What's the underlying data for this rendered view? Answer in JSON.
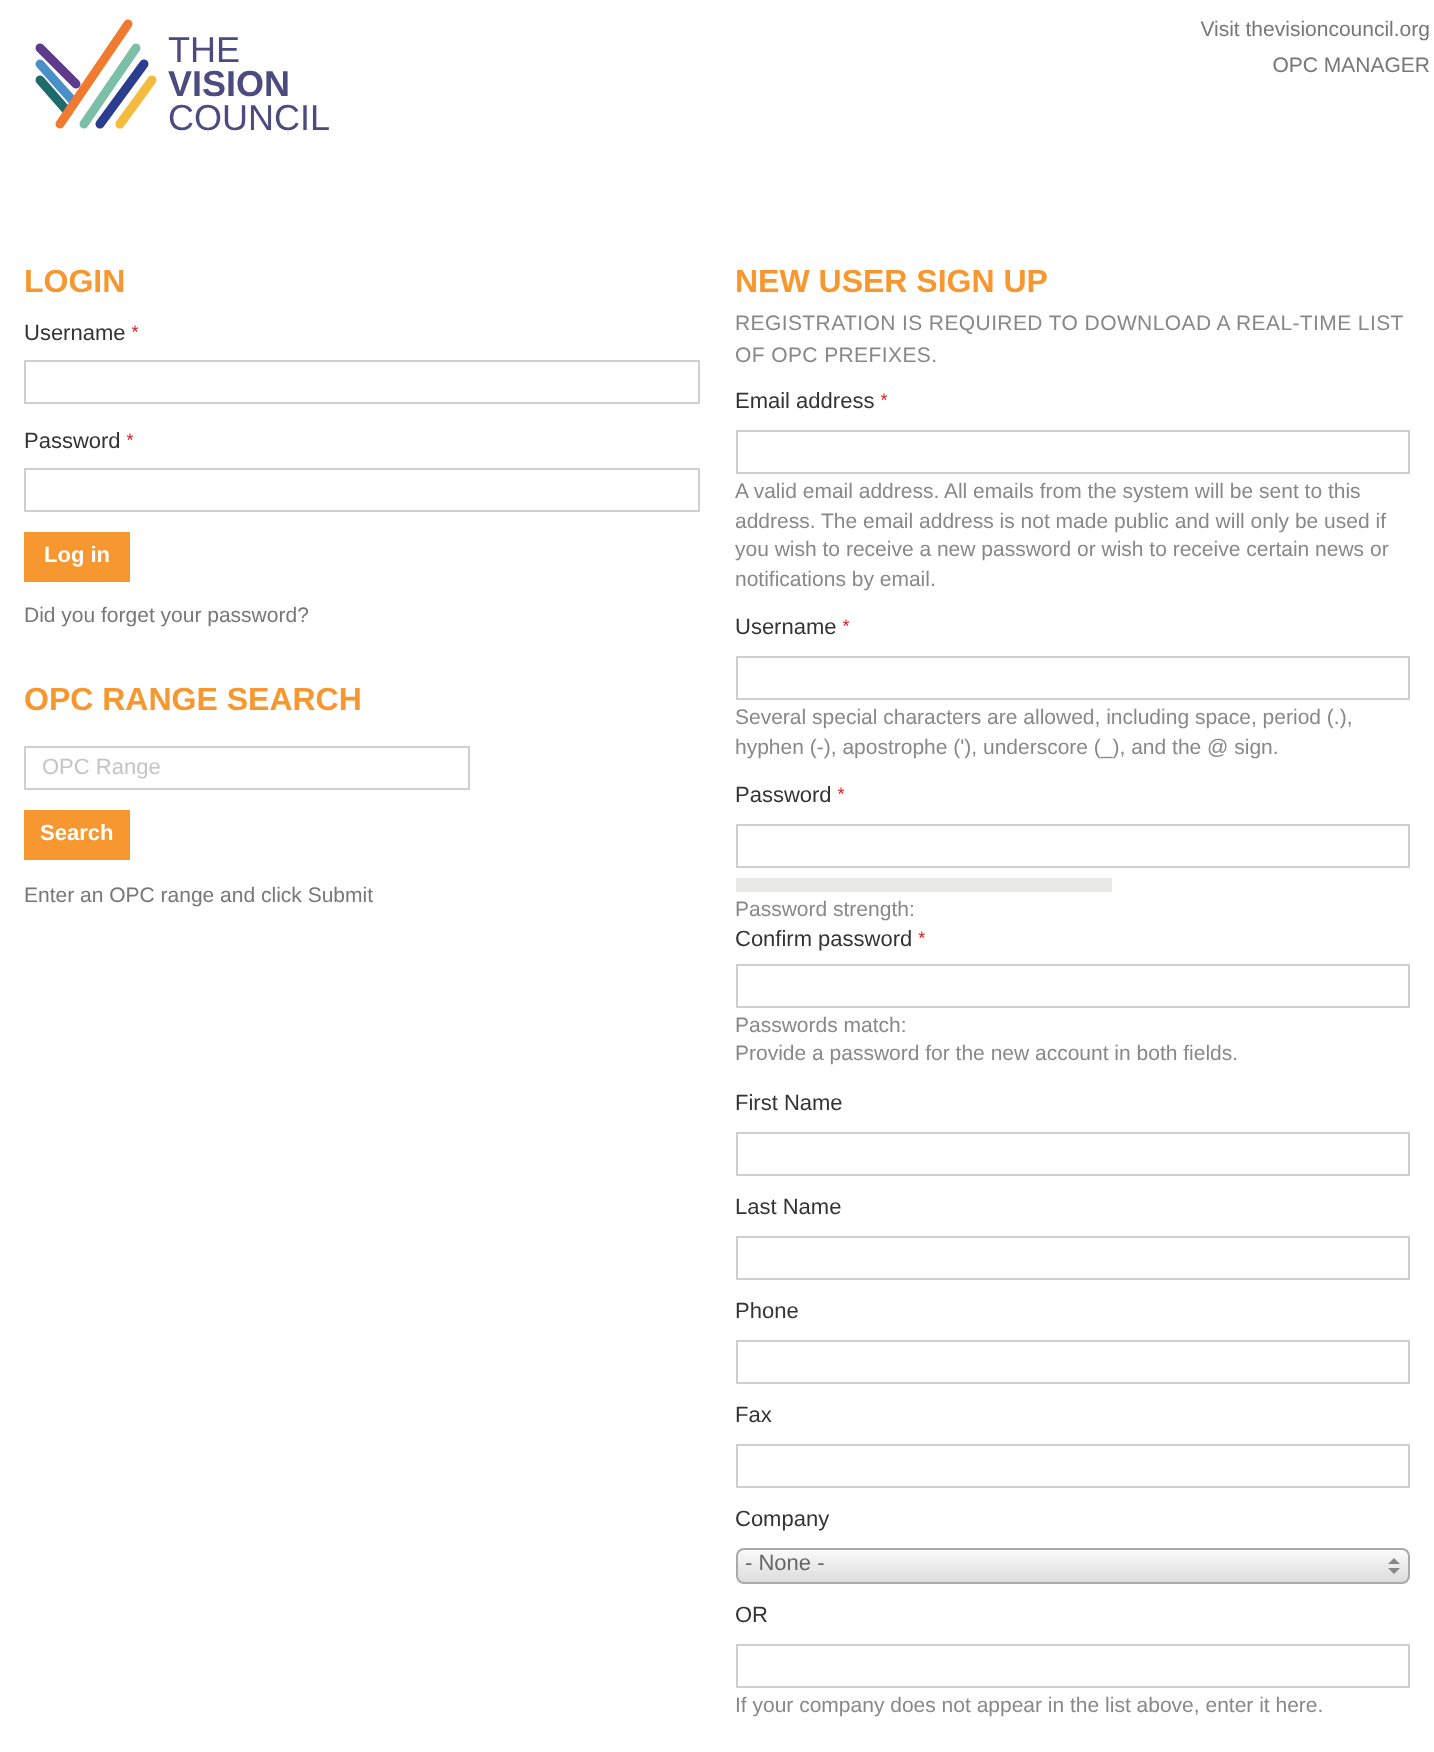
{
  "header": {
    "logo_words": [
      "THE",
      "VISION",
      "COUNCIL"
    ],
    "links": [
      "Visit thevisioncouncil.org",
      "OPC MANAGER"
    ]
  },
  "login": {
    "title": "LOGIN",
    "fields": [
      {
        "label": "Username",
        "required_mark": "*"
      },
      {
        "label": "Password",
        "required_mark": "*"
      }
    ],
    "button": "Log in",
    "link": "Did you forget your password?"
  },
  "opc_search": {
    "title": "OPC RANGE SEARCH",
    "placeholder": "OPC Range",
    "button": "Search",
    "help": "Enter an OPC range and click Submit"
  },
  "signup": {
    "title": "NEW USER SIGN UP",
    "intro": "REGISTRATION IS REQUIRED TO DOWNLOAD A REAL-TIME LIST OF OPC PREFIXES.",
    "fields": [
      {
        "kind": "text",
        "label": "Email address",
        "required_mark": "*",
        "help": [
          "A valid email address. All emails from the system will be sent to this address. The email address is not made public and will only be used if you wish to receive a new password or wish to receive certain news or notifications by email."
        ]
      },
      {
        "kind": "text",
        "label": "Username",
        "required_mark": "*",
        "help": [
          "Several special characters are allowed, including space, period (.), hyphen (-), apostrophe ('), underscore (_), and the @ sign."
        ]
      },
      {
        "kind": "password",
        "label": "Password",
        "required_mark": "*",
        "help": [
          "Password strength:"
        ]
      },
      {
        "kind": "text",
        "label": "Confirm password",
        "required_mark": "*",
        "help": [
          "Passwords match:",
          "Provide a password for the new account in both fields."
        ]
      },
      {
        "kind": "text",
        "label": "First Name"
      },
      {
        "kind": "text",
        "label": "Last Name"
      },
      {
        "kind": "text",
        "label": "Phone"
      },
      {
        "kind": "text",
        "label": "Fax"
      },
      {
        "kind": "select",
        "label": "Company",
        "value": "- None -"
      },
      {
        "kind": "text",
        "label": "OR",
        "help": [
          "If your company does not appear in the list above, enter it here."
        ]
      }
    ]
  }
}
